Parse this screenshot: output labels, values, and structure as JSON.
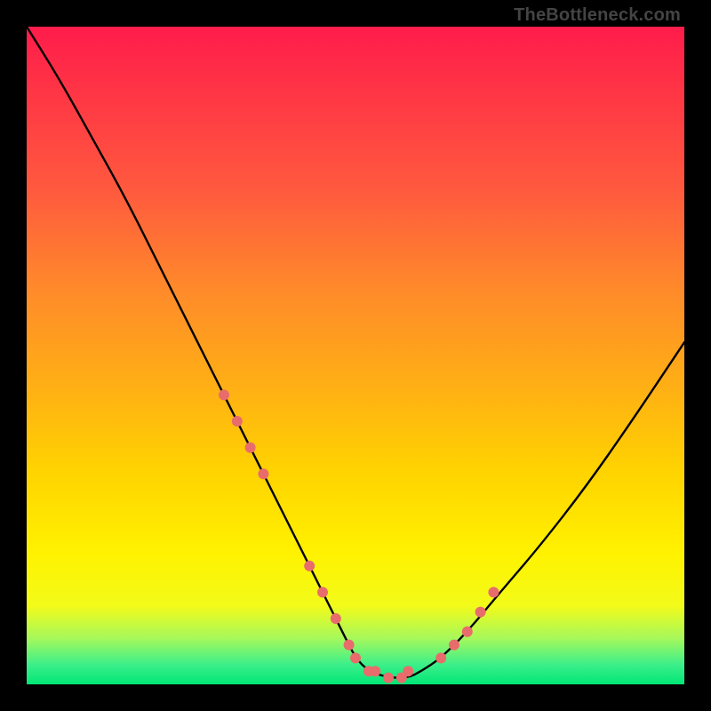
{
  "watermark": "TheBottleneck.com",
  "chart_data": {
    "type": "line",
    "title": "",
    "xlabel": "",
    "ylabel": "",
    "xlim": [
      0,
      100
    ],
    "ylim": [
      0,
      100
    ],
    "grid": false,
    "legend": false,
    "series": [
      {
        "name": "bottleneck-curve",
        "x": [
          0,
          5,
          10,
          15,
          20,
          25,
          30,
          35,
          40,
          45,
          48,
          50,
          52,
          55,
          58,
          60,
          63,
          67,
          72,
          78,
          85,
          92,
          100
        ],
        "values": [
          100,
          92,
          83,
          74,
          64,
          54,
          44,
          34,
          24,
          14,
          8,
          4,
          2,
          1,
          1,
          2,
          4,
          8,
          14,
          21,
          30,
          40,
          52
        ]
      }
    ],
    "highlight_points": {
      "name": "marker-dots",
      "color": "#e86c6c",
      "x": [
        30,
        32,
        34,
        36,
        43,
        45,
        47,
        49,
        50,
        52,
        53,
        55,
        57,
        58,
        63,
        65,
        67,
        69,
        71
      ],
      "values": [
        44,
        40,
        36,
        32,
        18,
        14,
        10,
        6,
        4,
        2,
        2,
        1,
        1,
        2,
        4,
        6,
        8,
        11,
        14
      ]
    },
    "background_gradient": {
      "top": "#ff1c4b",
      "mid_upper": "#ff8a2a",
      "mid": "#ffd400",
      "mid_lower": "#fff200",
      "bottom": "#00e676"
    }
  }
}
